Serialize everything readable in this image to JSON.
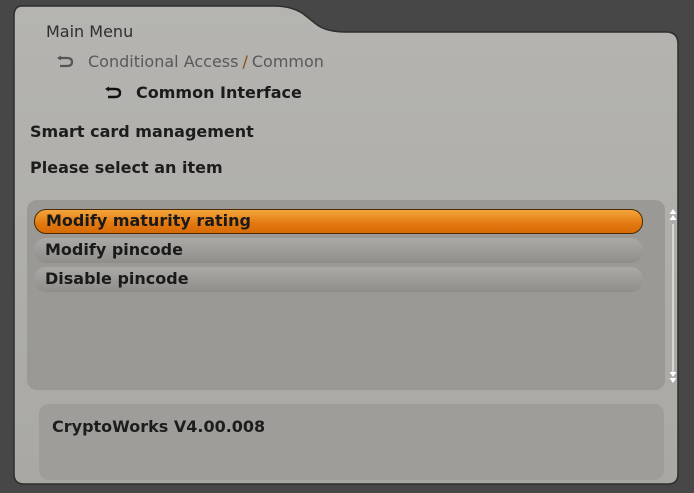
{
  "breadcrumb": {
    "root": "Main Menu",
    "level1_part1": "Conditional Access",
    "level1_separator": "/",
    "level1_part2": "Common",
    "level2": "Common Interface"
  },
  "page": {
    "title": "Smart card management",
    "subtitle": "Please select an item"
  },
  "menu": {
    "items": [
      {
        "label": "Modify maturity rating",
        "selected": true
      },
      {
        "label": "Modify pincode",
        "selected": false
      },
      {
        "label": "Disable pincode",
        "selected": false
      }
    ]
  },
  "info": {
    "text": "CryptoWorks V4.00.008"
  },
  "icons": {
    "breadcrumb_arrow": "return-arrow-icon",
    "scroll_up": "scroll-up-icon",
    "scroll_down": "scroll-down-icon"
  },
  "colors": {
    "background": "#474747",
    "panel": "#aeada9",
    "selected_item": "#e8820f",
    "item": "#9e9d99"
  }
}
